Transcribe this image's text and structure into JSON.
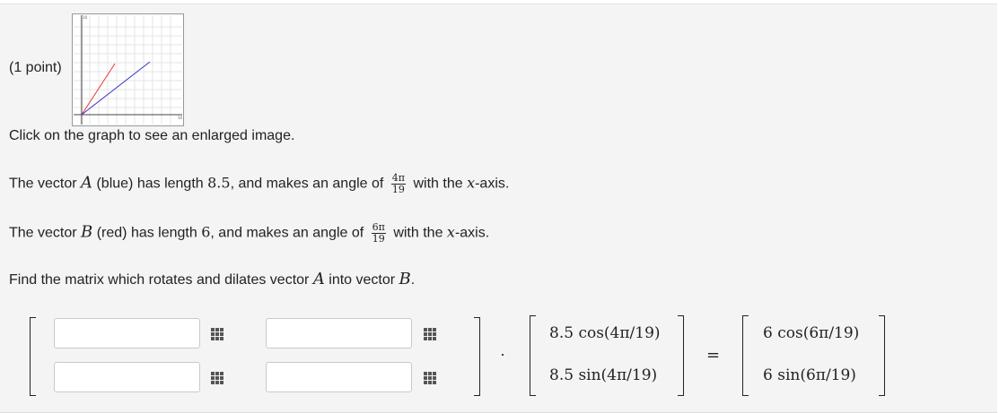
{
  "problem": {
    "points_label": "(1 point)",
    "enlarge_hint": "Click on the graph to see an enlarged image.",
    "vectorA": {
      "prefix": "The vector ",
      "name": "A",
      "mid": " (blue) has length ",
      "length": "8.5",
      "angle_pre": ", and makes an angle of ",
      "angle_num": "4π",
      "angle_den": "19",
      "suffix_pre": " with the ",
      "axis": "x",
      "suffix": "-axis."
    },
    "vectorB": {
      "prefix": "The vector ",
      "name": "B",
      "mid": " (red) has length ",
      "length": "6",
      "angle_pre": ", and makes an angle of ",
      "angle_num": "6π",
      "angle_den": "19",
      "suffix_pre": " with the ",
      "axis": "x",
      "suffix": "-axis."
    },
    "instruction": {
      "pre": "Find the matrix which rotates and dilates vector ",
      "a": "A",
      "mid": " into vector ",
      "b": "B",
      "end": "."
    }
  },
  "equation": {
    "dot": "·",
    "equals": "=",
    "vecA": [
      "8.5 cos(4π/19)",
      "8.5 sin(4π/19)"
    ],
    "vecB": [
      "6 cos(6π/19)",
      "6 sin(6π/19)"
    ],
    "inputs": [
      "",
      "",
      "",
      ""
    ]
  },
  "graph": {
    "vectors": [
      {
        "name": "A",
        "color": "#3333cc",
        "length": 8.5,
        "angle": "4π/19"
      },
      {
        "name": "B",
        "color": "#ee3333",
        "length": 6,
        "angle": "6π/19"
      }
    ]
  },
  "colors": {
    "panel_bg": "#f4f4f4",
    "blue": "#3333cc",
    "red": "#ee3333"
  }
}
